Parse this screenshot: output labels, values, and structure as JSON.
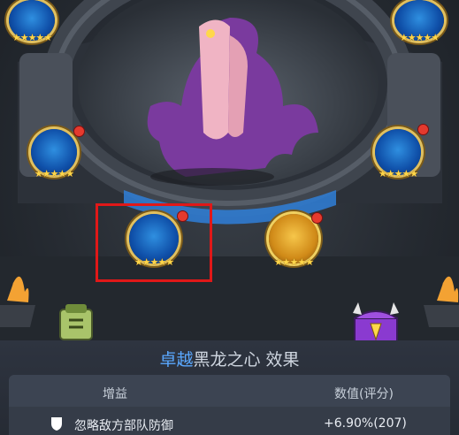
{
  "heroes": {
    "top_left": {
      "star_count": 5
    },
    "top_right": {
      "star_count": 5
    },
    "mid_left": {
      "star_count": 5,
      "has_notification": true
    },
    "mid_right": {
      "star_count": 5,
      "has_notification": true
    },
    "bottom_left_selected": {
      "star_count": 5,
      "has_notification": true
    },
    "bottom_right": {
      "star_count": 5,
      "has_notification": true
    }
  },
  "effect_panel": {
    "title_highlight": "卓越",
    "title_rest": "黑龙之心 效果",
    "columns": {
      "buff": "增益",
      "value": "数值(评分)"
    },
    "rows": [
      {
        "buff": "忽略敌方部队防御",
        "value": "+6.90%(207)"
      }
    ]
  },
  "colors": {
    "highlight_title": "#5aa8ff",
    "selection_box": "#e01818",
    "notification_dot": "#e53a2e"
  }
}
